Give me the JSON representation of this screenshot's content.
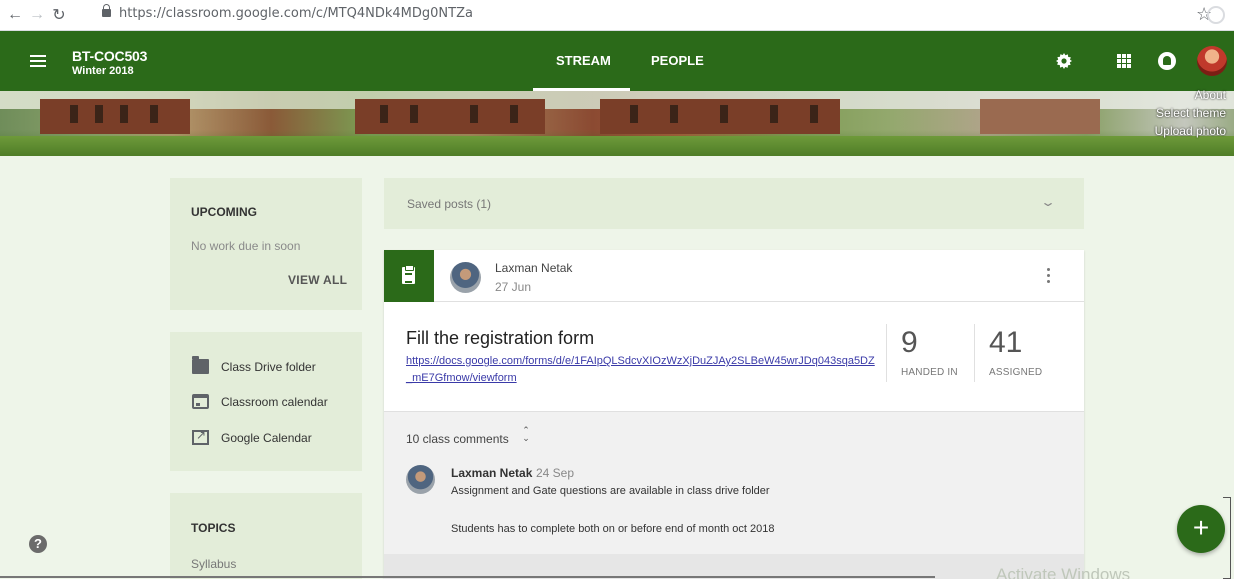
{
  "browser": {
    "url": "https://classroom.google.com/c/MTQ4NDk4MDg0NTZa",
    "back_icon": "arrow-left-icon",
    "forward_icon": "arrow-right-icon",
    "reload_icon": "reload-icon",
    "star_icon": "star-icon"
  },
  "header": {
    "class_name": "BT-COC503",
    "class_section": "Winter 2018",
    "tabs": [
      {
        "label": "STREAM",
        "active": true
      },
      {
        "label": "PEOPLE",
        "active": false
      }
    ],
    "accent_color": "#2b6a19"
  },
  "banner": {
    "about": "About",
    "select_theme": "Select theme",
    "upload_photo": "Upload photo"
  },
  "upcoming": {
    "heading": "UPCOMING",
    "empty_text": "No work due in soon",
    "view_all": "VIEW ALL"
  },
  "links": {
    "class_drive": "Class Drive folder",
    "classroom_calendar": "Classroom calendar",
    "google_calendar": "Google Calendar"
  },
  "topics": {
    "heading": "TOPICS",
    "items": [
      "Syllabus"
    ]
  },
  "saved_posts": {
    "label": "Saved posts (1)"
  },
  "post": {
    "author": "Laxman Netak",
    "date": "27 Jun",
    "title": "Fill the registration form",
    "link": "https://docs.google.com/forms/d/e/1FAIpQLSdcvXIOzWzXjDuZJAy2SLBeW45wrJDq043sqa5DZ_mE7Gfmow/viewform",
    "handed_in_count": "9",
    "handed_in_label": "HANDED IN",
    "assigned_count": "41",
    "assigned_label": "ASSIGNED",
    "comments_count_label": "10 class comments",
    "comment": {
      "author": "Laxman Netak",
      "date": "24 Sep",
      "line1": "Assignment and Gate questions are available in class drive folder",
      "line2": "Students has to complete both on or before end of month oct 2018"
    }
  },
  "fab_label": "+",
  "help_label": "?",
  "watermark": "Activate Windows"
}
